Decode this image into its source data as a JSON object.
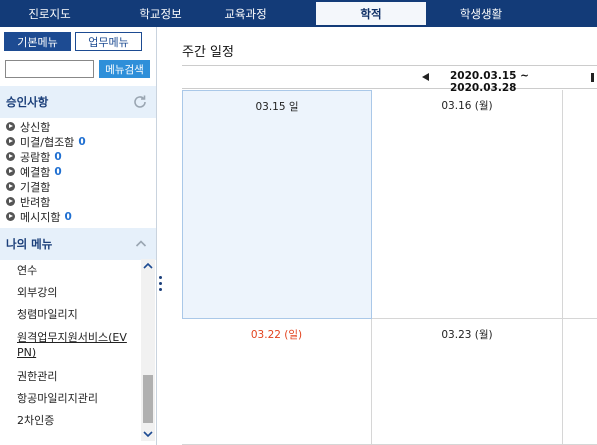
{
  "topnav": {
    "tabs": [
      {
        "label": "진로지도"
      },
      {
        "label": "학교정보"
      },
      {
        "label": "교육과정"
      },
      {
        "label": "학적"
      },
      {
        "label": "학생생활"
      }
    ],
    "active_index": 3
  },
  "sidebar": {
    "tabs": [
      {
        "label": "기본메뉴"
      },
      {
        "label": "업무메뉴"
      }
    ],
    "search": {
      "value": "",
      "button_label": "메뉴검색"
    },
    "approval": {
      "title": "승인사항",
      "items": [
        {
          "label": "상신함",
          "count": ""
        },
        {
          "label": "미결/협조함",
          "count": "0"
        },
        {
          "label": "공람함",
          "count": "0"
        },
        {
          "label": "예결함",
          "count": "0"
        },
        {
          "label": "기결함",
          "count": ""
        },
        {
          "label": "반려함",
          "count": ""
        },
        {
          "label": "메시지함",
          "count": "0"
        }
      ]
    },
    "my_menu": {
      "title": "나의 메뉴",
      "items": [
        {
          "label": "연수"
        },
        {
          "label": "외부강의"
        },
        {
          "label": "청렴마일리지"
        },
        {
          "label": "원격업무지원서비스(EVPN)",
          "line1": "원격업무지원서비스(EV",
          "line2": "PN)"
        },
        {
          "label": "권한관리"
        },
        {
          "label": "항공마일리지관리"
        },
        {
          "label": "2차인증"
        }
      ]
    }
  },
  "main": {
    "title": "주간 일정",
    "week_range": "2020.03.15 ~ 2020.03.28",
    "days": [
      {
        "label": "03.15 일"
      },
      {
        "label": "03.16 (월)"
      },
      {
        "label": "03.22 (일)"
      },
      {
        "label": "03.23 (월)"
      }
    ]
  },
  "colors": {
    "nav_bg": "#133b78",
    "accent": "#1d4b92",
    "search_button": "#2e8fd9",
    "count_blue": "#1f6fd1",
    "sunday_red": "#e2431e",
    "today_bg": "#edf4fc"
  }
}
